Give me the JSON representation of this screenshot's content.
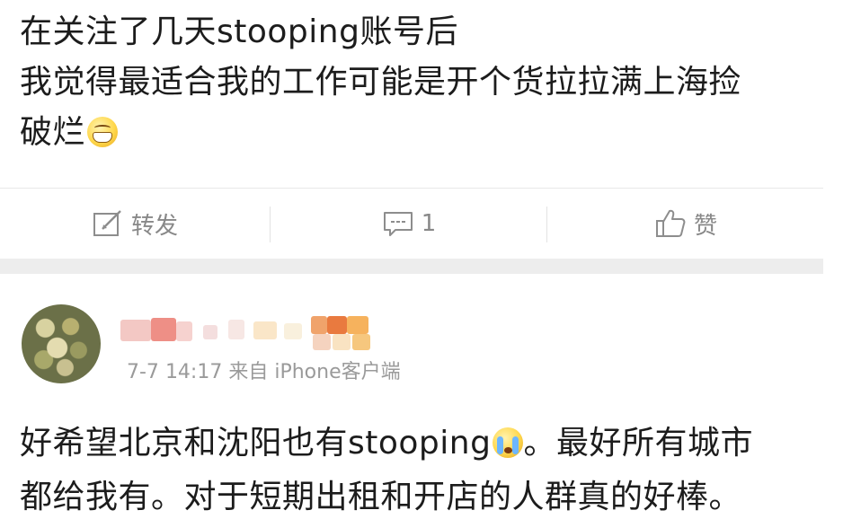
{
  "post": {
    "lines": [
      "在关注了几天stooping账号后",
      "我觉得最适合我的工作可能是开个货拉拉满上海捡",
      "破烂"
    ],
    "emoji_end": "grin-emoji"
  },
  "actions": {
    "repost_label": "转发",
    "comment_count": "1",
    "like_label": "赞"
  },
  "comment": {
    "date": "7-7",
    "time": "14:17",
    "source": "来自 iPhone客户端",
    "line1_before_emoji": "好希望北京和沈阳也有stooping",
    "line1_after_emoji": "。最好所有城市",
    "line2": "都给我有。对于短期出租和开店的人群真的好棒。",
    "emoji_inline": "crying-emoji"
  },
  "colors": {
    "text": "#1c1c1c",
    "muted": "#888888",
    "meta": "#9a9a9a",
    "separator_band": "#ededed"
  }
}
